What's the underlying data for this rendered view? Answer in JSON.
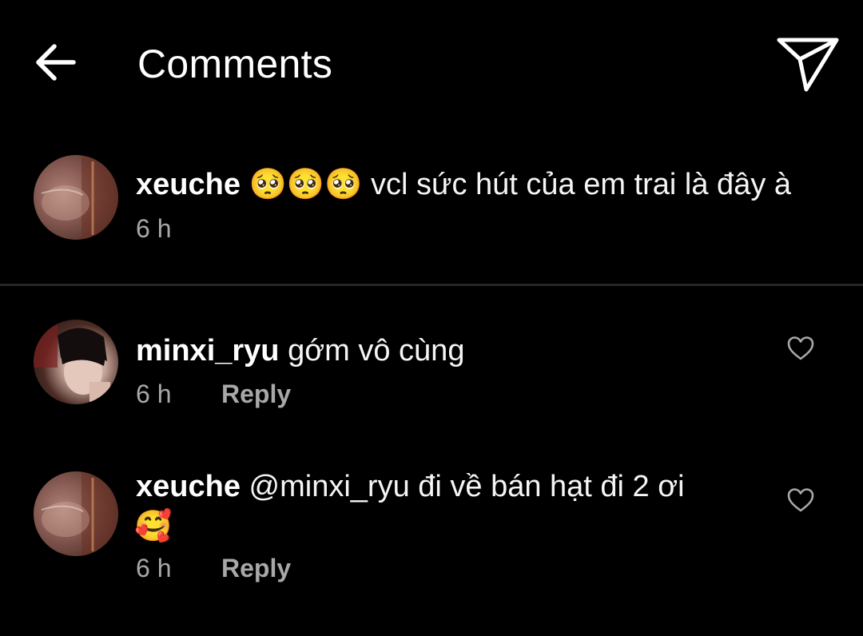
{
  "header": {
    "title": "Comments",
    "back_icon": "arrow-left-icon",
    "share_icon": "paper-plane-icon"
  },
  "caption": {
    "username": "xeuche",
    "text": "🥺🥺🥺 vcl sức hút của em trai là đây à",
    "time": "6 h"
  },
  "comments": [
    {
      "username": "minxi_ryu",
      "text": "gớm vô cùng",
      "time": "6 h",
      "reply_label": "Reply",
      "like_icon": "heart-outline-icon"
    },
    {
      "username": "xeuche",
      "text": "@minxi_ryu đi về bán hạt đi 2 ơi",
      "text_line2": "🥰",
      "time": "6 h",
      "reply_label": "Reply",
      "like_icon": "heart-outline-icon"
    }
  ],
  "colors": {
    "background": "#000000",
    "text": "#ffffff",
    "secondary_text": "#a8a8a8",
    "divider": "#262626"
  }
}
